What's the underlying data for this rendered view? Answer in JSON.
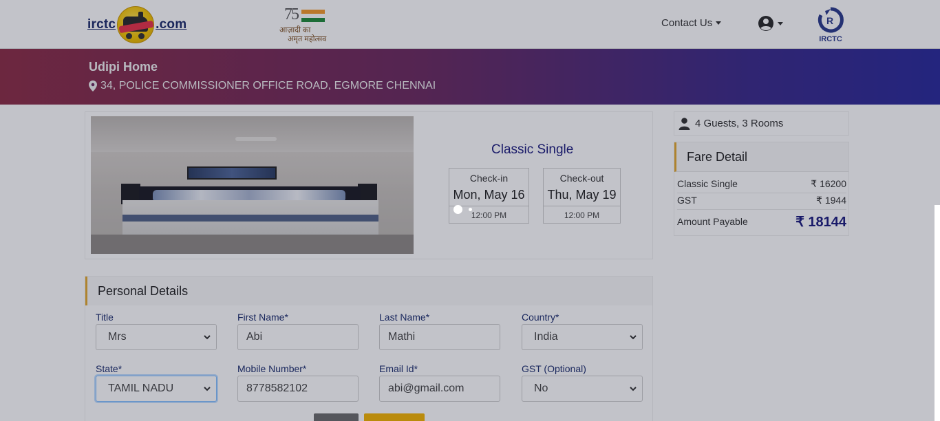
{
  "header": {
    "brand_left": "irctc",
    "brand_right": ".com",
    "azadi_number": "75",
    "azadi_line1": "आज़ादी का",
    "azadi_line2": "अमृत महोत्सव",
    "contact_label": "Contact Us",
    "irctc_logo_text": "IRCTC"
  },
  "hotel": {
    "name": "Udipi Home",
    "address": "34, POLICE COMMISSIONER OFFICE ROAD, EGMORE CHENNAI"
  },
  "room": {
    "type": "Classic Single",
    "checkin": {
      "label": "Check-in",
      "date": "Mon, May 16",
      "time": "12:00 PM"
    },
    "checkout": {
      "label": "Check-out",
      "date": "Thu, May 19",
      "time": "12:00 PM"
    }
  },
  "sidebar": {
    "guests": "4 Guests, 3 Rooms",
    "fare": {
      "title": "Fare Detail",
      "rows": [
        {
          "label": "Classic Single",
          "amount": "₹ 16200"
        },
        {
          "label": "GST",
          "amount": "₹ 1944"
        },
        {
          "label": "Amount Payable",
          "amount": "₹ 18144"
        }
      ]
    }
  },
  "personal": {
    "title": "Personal Details",
    "fields": {
      "title": {
        "label": "Title",
        "value": "Mrs"
      },
      "first_name": {
        "label": "First Name*",
        "value": "Abi"
      },
      "last_name": {
        "label": "Last Name*",
        "value": "Mathi"
      },
      "country": {
        "label": "Country*",
        "value": "India"
      },
      "state": {
        "label": "State*",
        "value": "TAMIL NADU"
      },
      "mobile": {
        "label": "Mobile Number*",
        "value": "8778582102"
      },
      "email": {
        "label": "Email Id*",
        "value": "abi@gmail.com"
      },
      "gst": {
        "label": "GST (Optional)",
        "value": "No"
      }
    }
  },
  "colors": {
    "brand_navy": "#1c1c7e",
    "accent_gold": "#e5a92e",
    "banner_start": "#8c2d46",
    "banner_end": "#2a2a9a"
  }
}
